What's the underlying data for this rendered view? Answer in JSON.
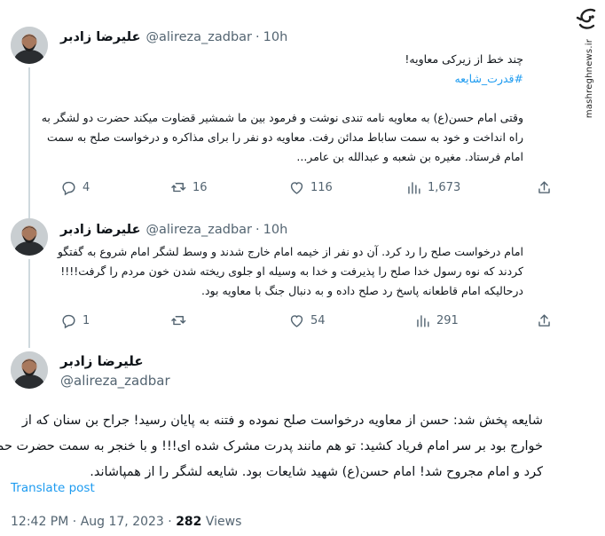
{
  "watermark": {
    "site": "mashreghnews.ir",
    "logo_icon": "mashregh-logo"
  },
  "tweets": [
    {
      "author_name": "علیرضا زادبر",
      "handle": "@alireza_zadbar",
      "separator": "·",
      "time": "10h",
      "lines": [
        "چند خط از زیرکی معاویه!",
        "#قدرت_شایعه",
        "",
        "وقتی امام حسن(ع) به معاویه نامه تندی نوشت و فرمود بین ما شمشیر قضاوت میکند حضرت دو لشگر به",
        "راه انداخت و خود به سمت ساباط مدائن رفت. معاویه دو نفر را برای مذاکره و درخواست صلح به سمت",
        "امام فرستاد. مغیره بن شعبه و عبدالله بن عامر..."
      ],
      "stats": {
        "replies": "4",
        "retweets": "16",
        "likes": "116",
        "views": "1,673"
      }
    },
    {
      "author_name": "علیرضا زادبر",
      "handle": "@alireza_zadbar",
      "separator": "·",
      "time": "10h",
      "lines": [
        "امام درخواست صلح را رد کرد. آن دو نفر از خیمه امام خارج شدند و وسط لشگر امام شروع به گفتگو",
        "کردند که نوه رسول خدا صلح را پذیرفت و خدا به وسیله او جلوی ریخته شدن خون مردم را گرفت!!!!",
        "درحالیکه امام قاطعانه پاسخ رد صلح داده و به دنبال جنگ با معاویه بود."
      ],
      "stats": {
        "replies": "1",
        "retweets": "",
        "likes": "54",
        "views": "291"
      }
    }
  ],
  "main_tweet": {
    "author_name": "علیرضا زادبر",
    "handle": "@alireza_zadbar",
    "lines": [
      "شایعه پخش شد: حسن از معاویه درخواست صلح نموده و فتنه به پایان رسید! جراح بن سنان که از",
      "خوارج بود بر سر امام فریاد کشید: تو هم مانند پدرت مشرک شده ای!!! و با خنجر به سمت حضرت حمله",
      "کرد و امام مجروح شد! امام حسن(ع) شهید شایعات بود. شایعه لشگر را از همپاشاند."
    ],
    "translate_label": "Translate post",
    "time": "12:42 PM",
    "separator": "·",
    "date": "Aug 17, 2023",
    "views_count": "282",
    "views_label": "Views"
  }
}
